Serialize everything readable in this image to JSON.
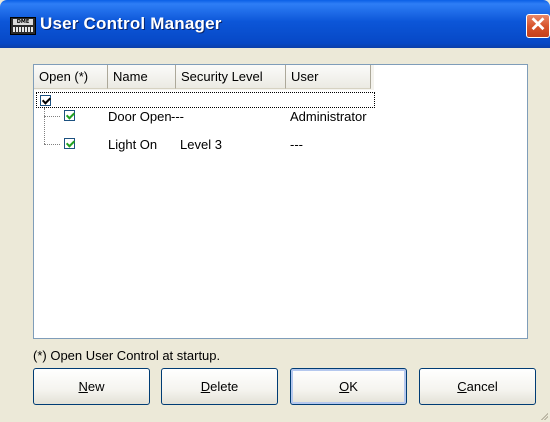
{
  "window": {
    "title": "User Control Manager",
    "icon": "dme-app-icon",
    "icon_text": "DME",
    "close_glyph": "✕"
  },
  "list": {
    "columns": [
      {
        "label": "Open (*)"
      },
      {
        "label": "Name"
      },
      {
        "label": "Security Level"
      },
      {
        "label": "User"
      }
    ],
    "rows": [
      {
        "checked": true,
        "name": "Door Open",
        "security_level": "---",
        "user": "Administrator"
      },
      {
        "checked": true,
        "name": "Light On",
        "security_level": "Level 3",
        "user": "---"
      }
    ],
    "root_checked": true
  },
  "footnote": "(*) Open User Control at startup.",
  "buttons": {
    "new": {
      "label": "New",
      "mnemonic": "N"
    },
    "delete": {
      "label": "Delete",
      "mnemonic": "D"
    },
    "ok": {
      "label": "OK",
      "mnemonic": "O"
    },
    "cancel": {
      "label": "Cancel",
      "mnemonic": "C"
    }
  },
  "colors": {
    "titlebar": "#0c56d8",
    "close": "#d8542c",
    "check": "#21a121"
  }
}
